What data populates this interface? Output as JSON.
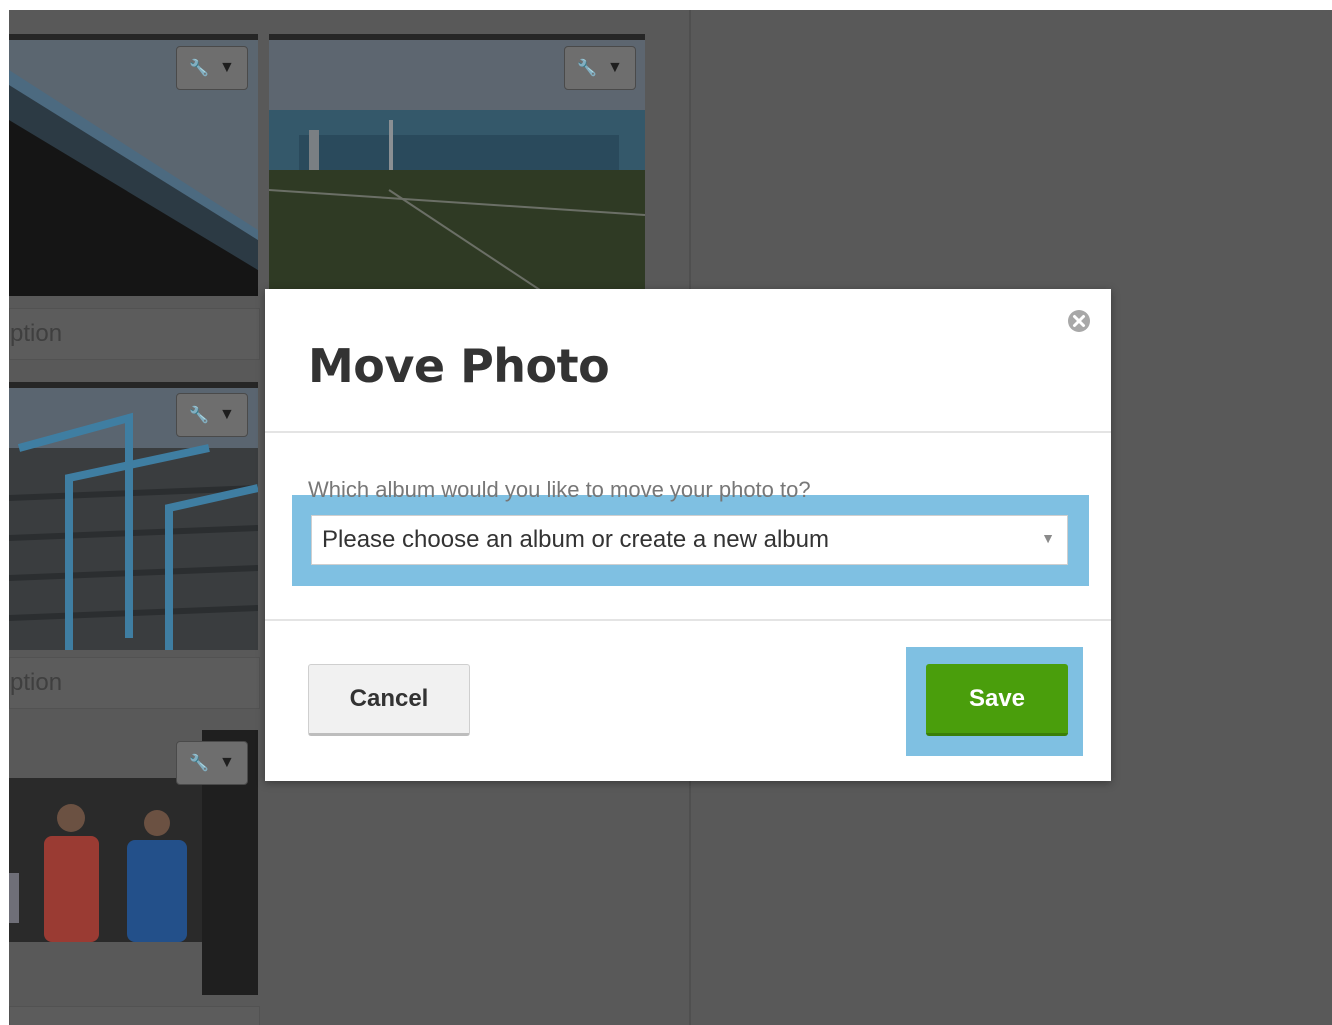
{
  "background": {
    "caption_partial_1": "ption",
    "caption_partial_2": "ption",
    "tool_icon": "wrench-icon",
    "dropdown_icon": "caret-down-icon"
  },
  "modal": {
    "title": "Move Photo",
    "close_icon": "close-circle-icon",
    "question": "Which album would you like to move your photo to?",
    "album_select": {
      "selected": "Please choose an album or create a new album",
      "arrow": "▼"
    },
    "cancel_label": "Cancel",
    "save_label": "Save"
  },
  "colors": {
    "save_green": "#4a9e0c",
    "highlight_blue": "#7fc0e2",
    "overlay_gray": "#595959"
  }
}
